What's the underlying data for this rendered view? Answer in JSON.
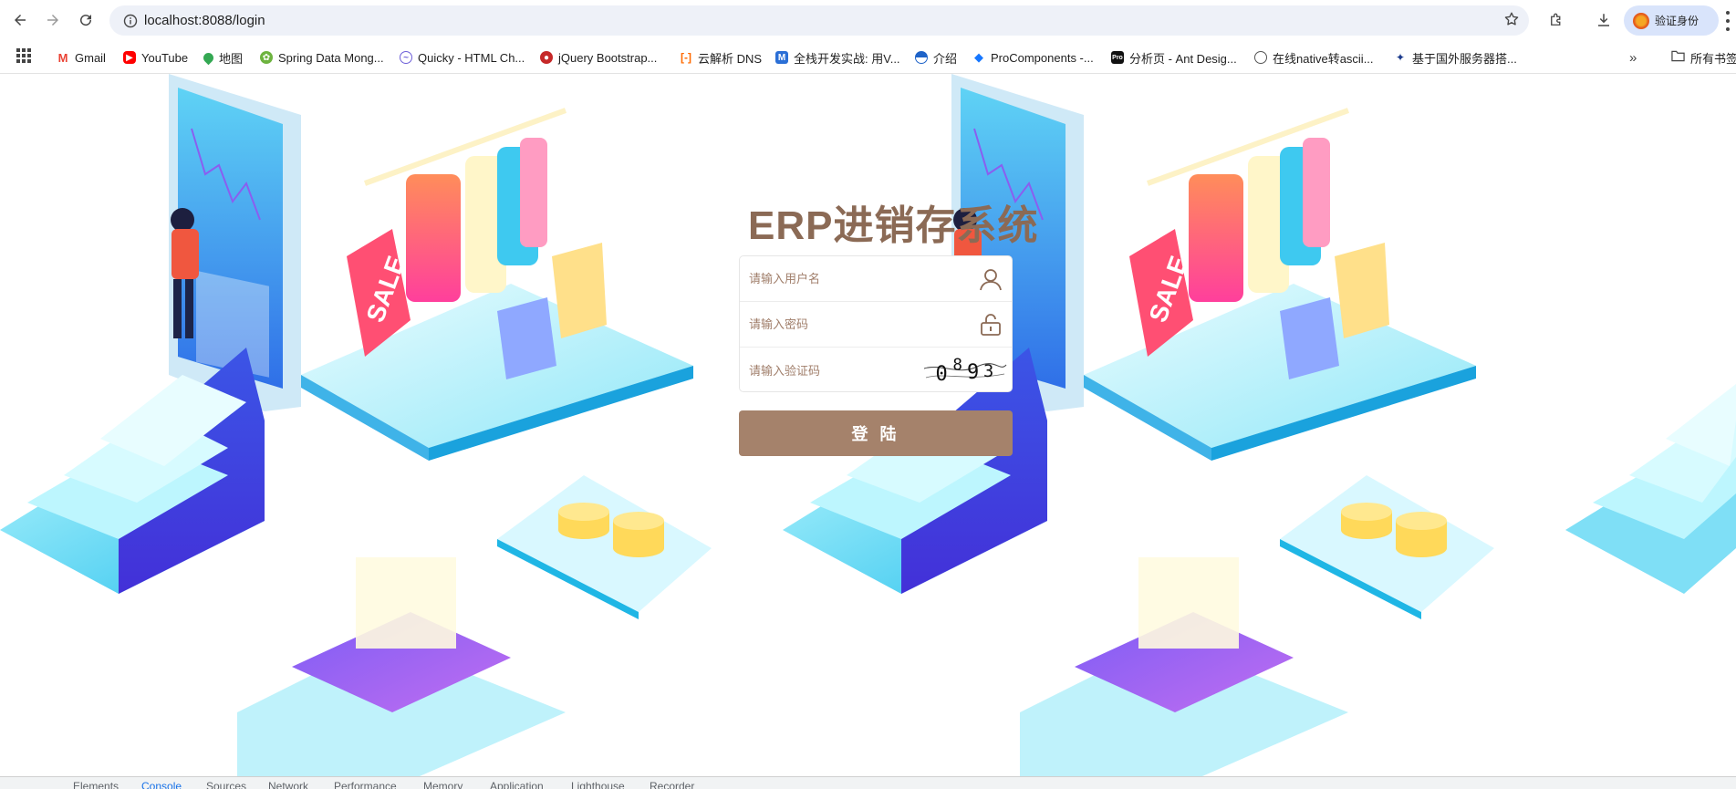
{
  "browser": {
    "url": "localhost:8088/login",
    "profile_label": "验证身份"
  },
  "bookmarks": {
    "items": [
      {
        "label": "Gmail",
        "icon": "gmail-icon"
      },
      {
        "label": "YouTube",
        "icon": "youtube-icon"
      },
      {
        "label": "地图",
        "icon": "maps-icon"
      },
      {
        "label": "Spring Data Mong...",
        "icon": "spring-icon"
      },
      {
        "label": "Quicky - HTML Ch...",
        "icon": "quicky-icon"
      },
      {
        "label": "jQuery Bootstrap...",
        "icon": "jquery-icon"
      },
      {
        "label": "云解析 DNS",
        "icon": "aliyun-icon"
      },
      {
        "label": "全栈开发实战: 用V...",
        "icon": "m-icon"
      },
      {
        "label": "介绍",
        "icon": "globe-blue-icon"
      },
      {
        "label": "ProComponents -...",
        "icon": "antd-icon"
      },
      {
        "label": "分析页 - Ant Desig...",
        "icon": "pro-icon"
      },
      {
        "label": "在线native转ascii...",
        "icon": "globe-icon"
      },
      {
        "label": "基于国外服务器搭...",
        "icon": "site-icon"
      }
    ],
    "all_bookmarks_label": "所有书签"
  },
  "login": {
    "title": "ERP进销存系统",
    "username_placeholder": "请输入用户名",
    "password_placeholder": "请输入密码",
    "captcha_placeholder": "请输入验证码",
    "captcha_chars": [
      "0",
      "8",
      "9",
      "3"
    ],
    "submit_label": "登 陆"
  },
  "devtools": {
    "tabs": [
      "Elements",
      "Console",
      "Sources",
      "Network",
      "Performance",
      "Memory",
      "Application",
      "Lighthouse",
      "Recorder"
    ],
    "active_tab": "Console"
  },
  "colors": {
    "accent": "#a5826b",
    "title": "#8b6a55",
    "placeholder": "#a07e6a"
  }
}
